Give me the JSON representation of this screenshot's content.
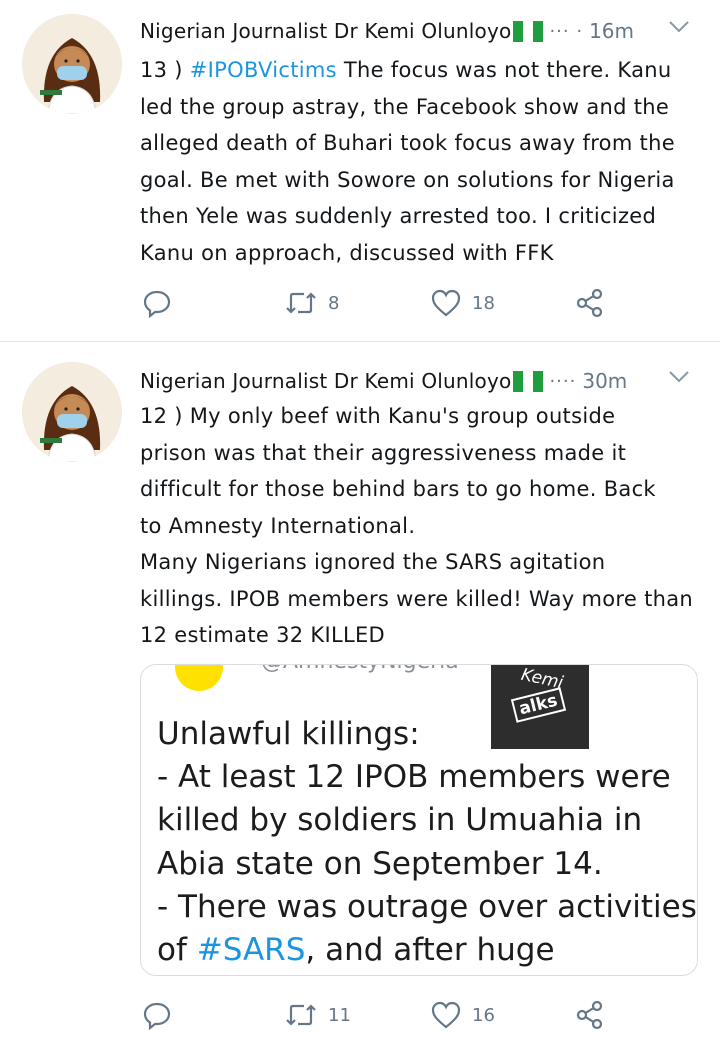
{
  "tweets": [
    {
      "author": "Nigerian Journalist Dr Kemi Olunloyo",
      "ellipsis": "··· ·",
      "time": "16m",
      "text_lines": [
        [
          "13 ) ",
          "#IPOBVictims",
          " The focus was not there. Kanu"
        ],
        [
          "led the group astray, the Facebook show and the"
        ],
        [
          "alleged death of Buhari took focus away from the"
        ],
        [
          "goal. Be met with Sowore on solutions for Nigeria"
        ],
        [
          "then Yele was suddenly arrested too. I criticized"
        ],
        [
          "Kanu on approach, discussed with FFK"
        ]
      ],
      "line_1": {
        "prefix": "13 ) ",
        "hashtag": "#IPOBVictims",
        "rest": " The focus was not there. Kanu"
      },
      "line_2": "led the group astray, the Facebook show and the",
      "line_3": "alleged death of Buhari took focus away from the",
      "line_4": "goal. Be met with Sowore on solutions for Nigeria",
      "line_5": "then Yele was suddenly arrested too. I criticized",
      "line_6": "Kanu on approach, discussed with FFK",
      "retweets": "8",
      "likes": "18"
    },
    {
      "author": "Nigerian Journalist Dr Kemi Olunloyo",
      "ellipsis": "····",
      "time": "30m",
      "line_1": "12 ) My only beef with Kanu's group outside",
      "line_2": "prison was that their aggressiveness made it",
      "line_3": "difficult for those behind bars to go home. Back",
      "line_4": "to Amnesty International.",
      "line_5": "Many Nigerians ignored the SARS agitation",
      "line_6": "killings. IPOB members were killed! Way more than",
      "line_7": "12 estimate 32 KILLED",
      "media": {
        "handle": "@AmnestyNigeria",
        "watermark_1": "Kemi",
        "watermark_2": "alks",
        "line_1": "Unlawful killings:",
        "line_2": "- At least 12 IPOB members were",
        "line_3": "killed by soldiers in Umuahia in",
        "line_4": "Abia state on September 14.",
        "line_5": "- There was outrage over activities",
        "line_6_prefix": "of ",
        "line_6_hashtag": "#SARS",
        "line_6_rest": ", and after huge pressure"
      },
      "retweets": "11",
      "likes": "16"
    }
  ],
  "icons": [
    "reply-icon",
    "retweet-icon",
    "like-icon",
    "share-icon",
    "chevron-down-icon",
    "nigeria-flag-icon"
  ],
  "colors": {
    "text": "#14171a",
    "muted": "#657786",
    "hashtag": "#1b95e0",
    "divider": "#e1e8ed",
    "flag_green": "#1f9e3f"
  }
}
